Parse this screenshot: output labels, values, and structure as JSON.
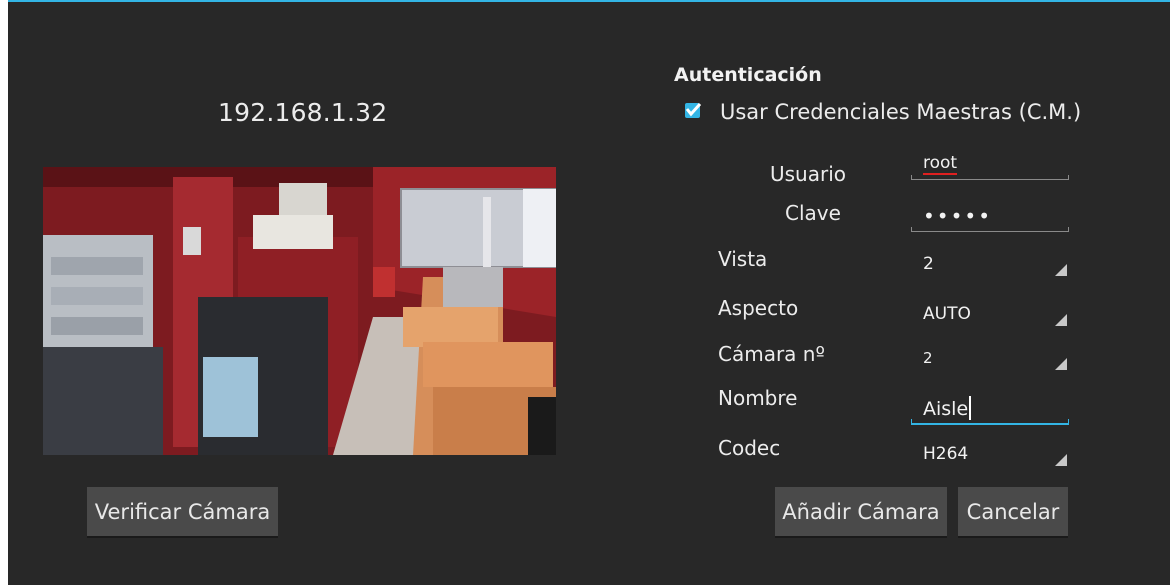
{
  "camera": {
    "ip_address": "192.168.1.32",
    "verify_button": "Verificar Cámara"
  },
  "auth": {
    "heading": "Autenticación",
    "use_master_credentials": {
      "label": "Usar Credenciales Maestras (C.M.)",
      "checked": true
    },
    "user": {
      "label": "Usuario",
      "value": "root"
    },
    "password": {
      "label": "Clave",
      "value": "•••••"
    }
  },
  "settings": {
    "view": {
      "label": "Vista",
      "value": "2"
    },
    "aspect": {
      "label": "Aspecto",
      "value": "AUTO"
    },
    "camera_number": {
      "label": "Cámara nº",
      "value": "2"
    },
    "name": {
      "label": "Nombre",
      "value": "Aisle"
    },
    "codec": {
      "label": "Codec",
      "value": "H264"
    }
  },
  "actions": {
    "add_camera": "Añadir Cámara",
    "cancel": "Cancelar"
  },
  "colors": {
    "accent": "#33b5e5",
    "background": "#282828",
    "button": "#4a4a4a"
  }
}
